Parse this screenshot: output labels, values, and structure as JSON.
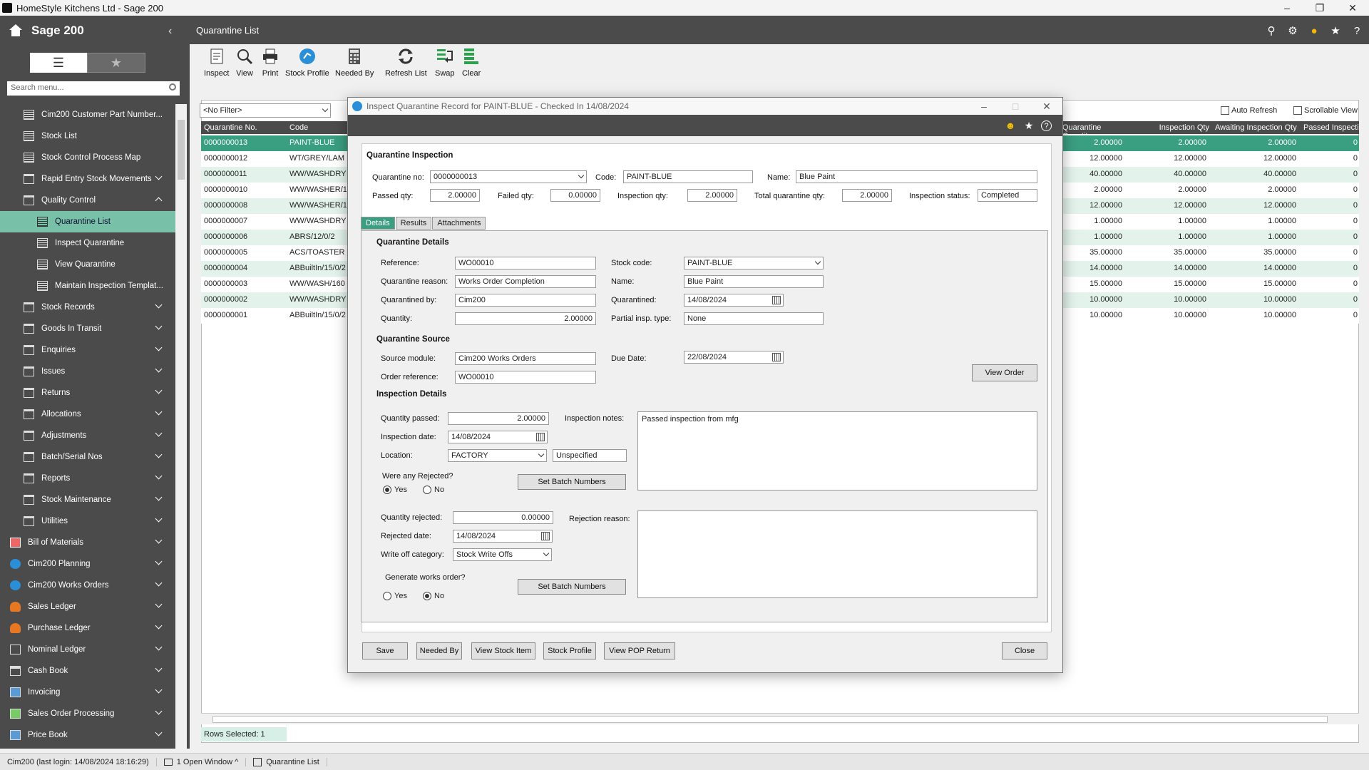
{
  "window": {
    "title": "HomeStyle Kitchens Ltd - Sage 200"
  },
  "sidebar": {
    "app_name": "Sage 200",
    "search_placeholder": "Search menu...",
    "items": [
      {
        "label": "Cim200 Customer Part Number...",
        "icon": "doc",
        "level": 1,
        "chev": ""
      },
      {
        "label": "Stock List",
        "icon": "doc",
        "level": 1,
        "chev": ""
      },
      {
        "label": "Stock Control Process Map",
        "icon": "doc",
        "level": 1,
        "chev": ""
      },
      {
        "label": "Rapid Entry Stock Movements",
        "icon": "folder",
        "level": 1,
        "chev": "down"
      },
      {
        "label": "Quality Control",
        "icon": "folder",
        "level": 1,
        "chev": "up"
      },
      {
        "label": "Quarantine List",
        "icon": "doc",
        "level": 2,
        "chev": "",
        "active": true
      },
      {
        "label": "Inspect Quarantine",
        "icon": "doc",
        "level": 2,
        "chev": ""
      },
      {
        "label": "View Quarantine",
        "icon": "doc",
        "level": 2,
        "chev": ""
      },
      {
        "label": "Maintain Inspection Templat...",
        "icon": "doc",
        "level": 2,
        "chev": ""
      },
      {
        "label": "Stock Records",
        "icon": "folder",
        "level": 1,
        "chev": "down"
      },
      {
        "label": "Goods In Transit",
        "icon": "folder",
        "level": 1,
        "chev": "down"
      },
      {
        "label": "Enquiries",
        "icon": "folder",
        "level": 1,
        "chev": "down"
      },
      {
        "label": "Issues",
        "icon": "folder",
        "level": 1,
        "chev": "down"
      },
      {
        "label": "Returns",
        "icon": "folder",
        "level": 1,
        "chev": "down"
      },
      {
        "label": "Allocations",
        "icon": "folder",
        "level": 1,
        "chev": "down"
      },
      {
        "label": "Adjustments",
        "icon": "folder",
        "level": 1,
        "chev": "down"
      },
      {
        "label": "Batch/Serial Nos",
        "icon": "folder",
        "level": 1,
        "chev": "down"
      },
      {
        "label": "Reports",
        "icon": "folder",
        "level": 1,
        "chev": "down"
      },
      {
        "label": "Stock Maintenance",
        "icon": "folder",
        "level": 1,
        "chev": "down"
      },
      {
        "label": "Utilities",
        "icon": "folder",
        "level": 1,
        "chev": "down"
      },
      {
        "label": "Bill of Materials",
        "icon": "box",
        "level": 0,
        "chev": "down"
      },
      {
        "label": "Cim200 Planning",
        "icon": "circle",
        "level": 0,
        "chev": "down"
      },
      {
        "label": "Cim200 Works Orders",
        "icon": "circle",
        "level": 0,
        "chev": "down"
      },
      {
        "label": "Sales Ledger",
        "icon": "person",
        "level": 0,
        "chev": "down"
      },
      {
        "label": "Purchase Ledger",
        "icon": "person",
        "level": 0,
        "chev": "down"
      },
      {
        "label": "Nominal Ledger",
        "icon": "book",
        "level": 0,
        "chev": "down"
      },
      {
        "label": "Cash Book",
        "icon": "bank",
        "level": 0,
        "chev": "down"
      },
      {
        "label": "Invoicing",
        "icon": "inv",
        "level": 0,
        "chev": "down"
      },
      {
        "label": "Sales Order Processing",
        "icon": "sales",
        "level": 0,
        "chev": "down"
      },
      {
        "label": "Price Book",
        "icon": "inv",
        "level": 0,
        "chev": "down"
      }
    ]
  },
  "main": {
    "title": "Quarantine List"
  },
  "toolbar": {
    "inspect": "Inspect",
    "view": "View",
    "print": "Print",
    "stock_profile": "Stock Profile",
    "needed_by": "Needed By",
    "refresh": "Refresh List",
    "swap": "Swap",
    "clear": "Clear"
  },
  "grid": {
    "filter": "<No Filter>",
    "auto_refresh": "Auto Refresh",
    "scrollable_view": "Scrollable View",
    "columns": [
      "Quarantine No.",
      "Code",
      "Quarantine Quantity",
      "Inspection Qty",
      "Awaiting Inspection Qty",
      "Passed Inspecti"
    ],
    "rows": [
      [
        "0000000013",
        "PAINT-BLUE",
        "2.00000",
        "2.00000",
        "2.00000",
        "0"
      ],
      [
        "0000000012",
        "WT/GREY/LAM",
        "12.00000",
        "12.00000",
        "12.00000",
        "0"
      ],
      [
        "0000000011",
        "WW/WASHDRY",
        "40.00000",
        "40.00000",
        "40.00000",
        "0"
      ],
      [
        "0000000010",
        "WW/WASHER/1",
        "2.00000",
        "2.00000",
        "2.00000",
        "0"
      ],
      [
        "0000000008",
        "WW/WASHER/1",
        "12.00000",
        "12.00000",
        "12.00000",
        "0"
      ],
      [
        "0000000007",
        "WW/WASHDRY",
        "1.00000",
        "1.00000",
        "1.00000",
        "0"
      ],
      [
        "0000000006",
        "ABRS/12/0/2",
        "1.00000",
        "1.00000",
        "1.00000",
        "0"
      ],
      [
        "0000000005",
        "ACS/TOASTER",
        "35.00000",
        "35.00000",
        "35.00000",
        "0"
      ],
      [
        "0000000004",
        "ABBuiltIn/15/0/2",
        "14.00000",
        "14.00000",
        "14.00000",
        "0"
      ],
      [
        "0000000003",
        "WW/WASH/160",
        "15.00000",
        "15.00000",
        "15.00000",
        "0"
      ],
      [
        "0000000002",
        "WW/WASHDRY",
        "10.00000",
        "10.00000",
        "10.00000",
        "0"
      ],
      [
        "0000000001",
        "ABBuiltIn/15/0/2",
        "10.00000",
        "10.00000",
        "10.00000",
        "0"
      ]
    ],
    "rows_selected": "Rows Selected: 1"
  },
  "status": {
    "login": "Cim200 (last login: 14/08/2024 18:16:29)",
    "windows": "1 Open Window ^",
    "tab": "Quarantine List"
  },
  "dialog": {
    "title": "Inspect Quarantine Record for PAINT-BLUE - Checked In 14/08/2024",
    "section": "Quarantine Inspection",
    "quarantine_no_label": "Quarantine no:",
    "quarantine_no": "0000000013",
    "code_label": "Code:",
    "code": "PAINT-BLUE",
    "name_label": "Name:",
    "name": "Blue Paint",
    "passed_label": "Passed qty:",
    "passed": "2.00000",
    "failed_label": "Failed qty:",
    "failed": "0.00000",
    "inspection_label": "Inspection qty:",
    "inspection": "2.00000",
    "total_label": "Total quarantine qty:",
    "total": "2.00000",
    "status_label": "Inspection status:",
    "status": "Completed",
    "tabs": [
      "Details",
      "Results",
      "Attachments"
    ],
    "details": {
      "qd_header": "Quarantine Details",
      "reference_label": "Reference:",
      "reference": "WO00010",
      "reason_label": "Quarantine reason:",
      "reason": "Works Order Completion",
      "by_label": "Quarantined by:",
      "by": "Cim200",
      "qty_label": "Quantity:",
      "qty": "2.00000",
      "stock_code_label": "Stock code:",
      "stock_code": "PAINT-BLUE",
      "name_label": "Name:",
      "name": "Blue Paint",
      "quarantined_label": "Quarantined:",
      "quarantined": "14/08/2024",
      "partial_label": "Partial insp. type:",
      "partial": "None",
      "qs_header": "Quarantine Source",
      "source_label": "Source module:",
      "source": "Cim200 Works Orders",
      "order_label": "Order reference:",
      "order": "WO00010",
      "due_label": "Due Date:",
      "due": "22/08/2024",
      "view_order": "View Order",
      "id_header": "Inspection Details",
      "qpassed_label": "Quantity passed:",
      "qpassed": "2.00000",
      "notes_label": "Inspection notes:",
      "notes": "Passed inspection from mfg",
      "idate_label": "Inspection date:",
      "idate": "14/08/2024",
      "loc_label": "Location:",
      "loc": "FACTORY",
      "loc2": "Unspecified",
      "rejected_q": "Were any Rejected?",
      "yes": "Yes",
      "no": "No",
      "set_batch": "Set Batch Numbers",
      "qrej_label": "Quantity rejected:",
      "qrej": "0.00000",
      "rdate_label": "Rejected date:",
      "rdate": "14/08/2024",
      "reason_rej_label": "Rejection reason:",
      "wo_cat_label": "Write off category:",
      "wo_cat": "Stock Write Offs",
      "gen_wo": "Generate works order?"
    },
    "buttons": {
      "save": "Save",
      "needed_by": "Needed By",
      "view_stock": "View Stock Item",
      "stock_profile": "Stock Profile",
      "view_pop": "View POP Return",
      "close": "Close"
    }
  }
}
